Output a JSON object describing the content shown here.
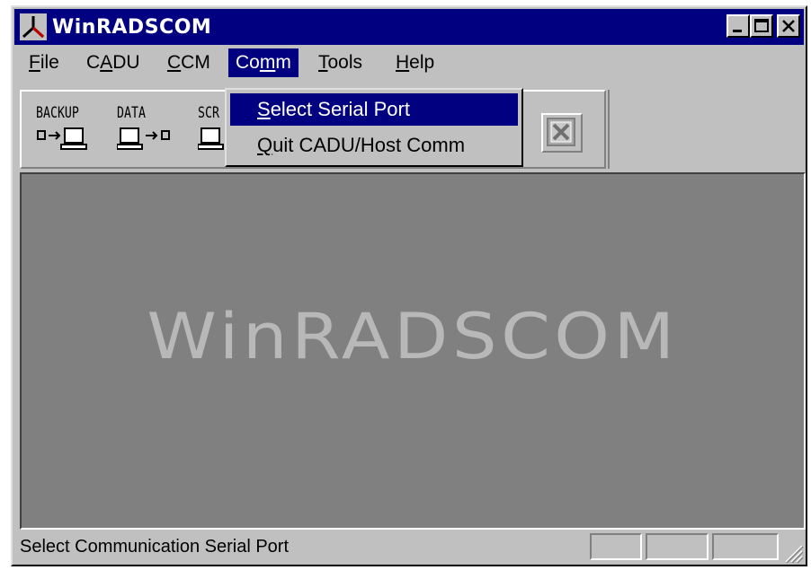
{
  "window": {
    "title": "WinRADSCOM",
    "controls": [
      "minimize",
      "maximize",
      "close"
    ]
  },
  "menubar": {
    "items": [
      {
        "label": "File",
        "mnemonic": "F"
      },
      {
        "label": "CADU",
        "mnemonic": "A"
      },
      {
        "label": "CCM",
        "mnemonic": "C"
      },
      {
        "label": "Comm",
        "mnemonic": "m",
        "active": true
      },
      {
        "label": "Tools",
        "mnemonic": "T"
      },
      {
        "label": "Help",
        "mnemonic": "H"
      }
    ]
  },
  "toolbar": {
    "tools": [
      {
        "label": "BACKUP",
        "icon": "backup-icon"
      },
      {
        "label": "DATA",
        "icon": "data-transfer-icon"
      },
      {
        "label": "SCR",
        "icon": "screen-icon"
      }
    ],
    "exit_icon": "exit-x-icon"
  },
  "comm_menu": {
    "items": [
      {
        "label": "Select Serial Port",
        "mnemonic": "S",
        "selected": true
      },
      {
        "label": "Quit CADU/Host Comm",
        "mnemonic": "Q",
        "selected": false
      }
    ]
  },
  "workspace": {
    "splash": "WinRADSCOM"
  },
  "statusbar": {
    "message": "Select Communication Serial Port"
  },
  "colors": {
    "titlebar": "#000080",
    "face": "#c0c0c0",
    "workspace": "#808080",
    "splash_text": "#b8b8b8",
    "highlight": "#000080"
  }
}
